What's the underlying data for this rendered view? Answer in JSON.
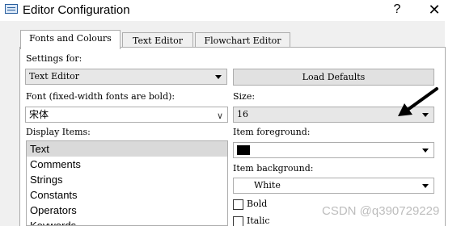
{
  "window": {
    "title": "Editor Configuration",
    "help_glyph": "?",
    "close_glyph": "✕"
  },
  "tabs": [
    {
      "label": "Fonts and Colours",
      "active": true
    },
    {
      "label": "Text Editor",
      "active": false
    },
    {
      "label": "Flowchart Editor",
      "active": false
    }
  ],
  "settings_for": {
    "label": "Settings for:",
    "value": "Text Editor"
  },
  "load_defaults": {
    "label": "Load Defaults"
  },
  "font": {
    "label": "Font (fixed-width fonts are bold):",
    "value": "宋体",
    "chevron": "∨"
  },
  "size": {
    "label": "Size:",
    "value": "16"
  },
  "display_items": {
    "label": "Display Items:",
    "items": [
      "Text",
      "Comments",
      "Strings",
      "Constants",
      "Operators",
      "Keywords"
    ],
    "selected_index": 0
  },
  "item_foreground": {
    "label": "Item foreground:",
    "color": "#000000"
  },
  "item_background": {
    "label": "Item background:",
    "value": "White",
    "color": "#ffffff"
  },
  "style_options": {
    "bold_label": "Bold",
    "bold_checked": false,
    "italic_label": "Italic",
    "italic_checked": false
  },
  "watermark": {
    "text": "CSDN @q390729229"
  },
  "colors": {
    "dialog_bg": "#f0f0f0",
    "panel_bg": "#ffffff",
    "selection": "#d9d9d9",
    "border": "#adadad"
  }
}
